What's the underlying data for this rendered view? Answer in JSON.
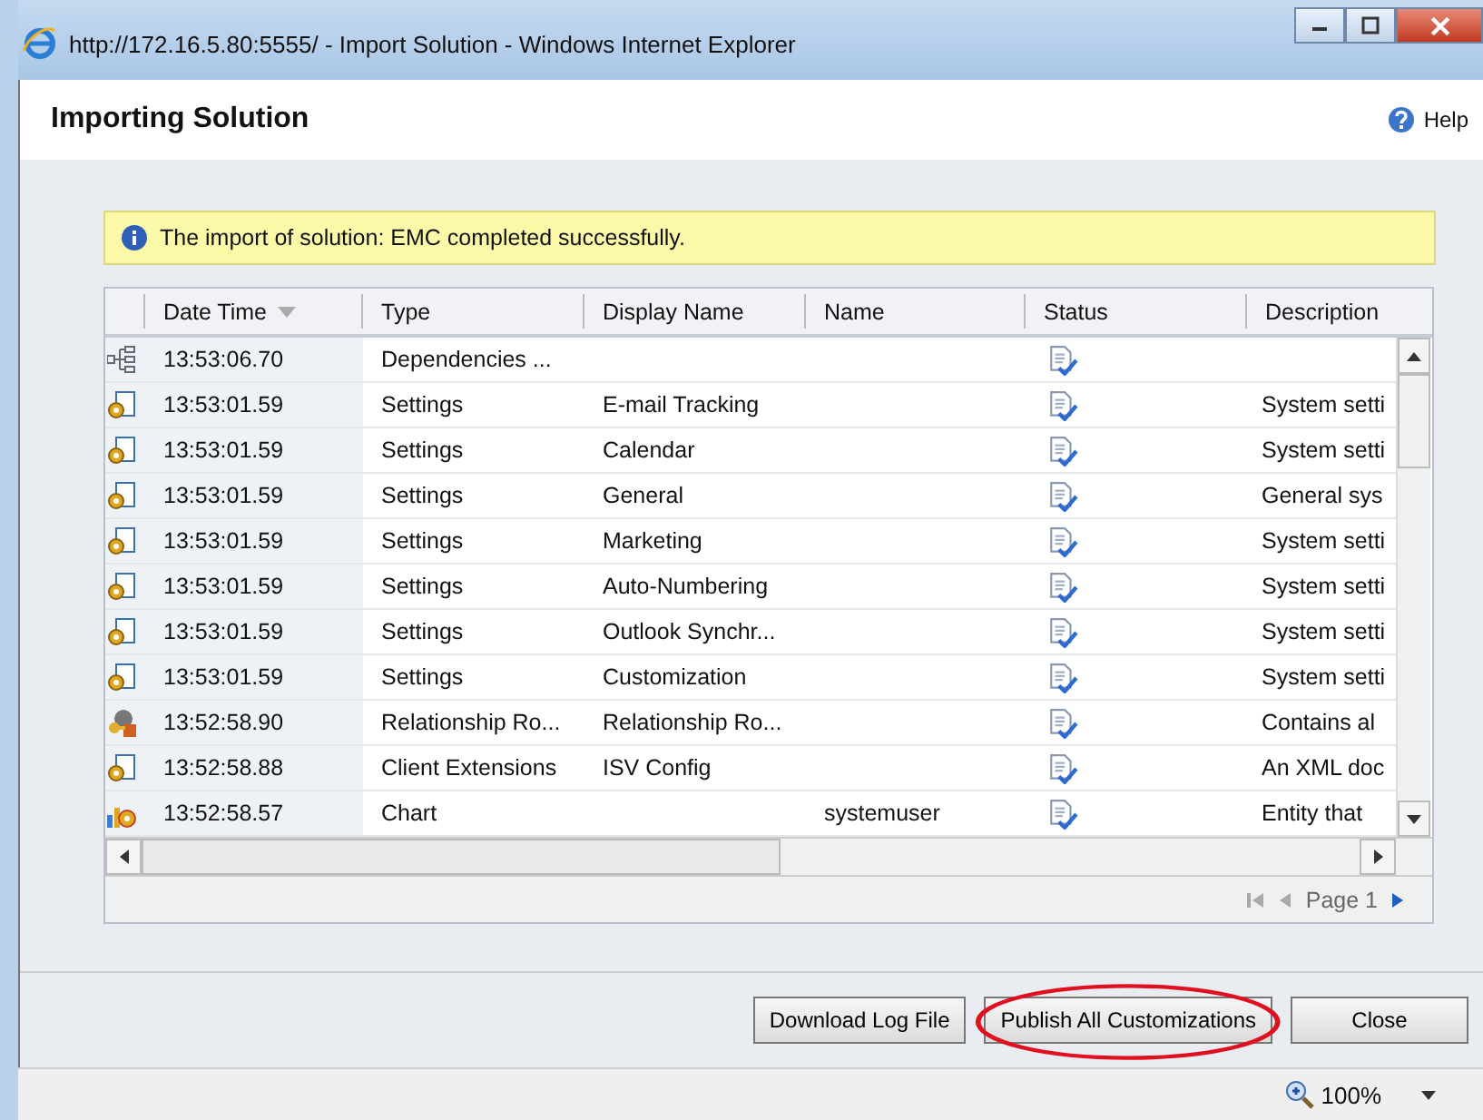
{
  "window": {
    "title": "http://172.16.5.80:5555/ - Import Solution - Windows Internet Explorer"
  },
  "dialog": {
    "title": "Importing Solution",
    "help": "Help"
  },
  "notice": "The import of solution: EMC completed successfully.",
  "table": {
    "columns": [
      {
        "label": "Date Time",
        "sorted": true
      },
      {
        "label": "Type",
        "sorted": false
      },
      {
        "label": "Display Name",
        "sorted": false
      },
      {
        "label": "Name",
        "sorted": false
      },
      {
        "label": "Status",
        "sorted": false
      },
      {
        "label": "Description",
        "sorted": false
      }
    ],
    "rows": [
      {
        "kind": "dependencies",
        "time": "13:53:06.70",
        "type": "Dependencies ...",
        "display_name": "",
        "name": "",
        "description": ""
      },
      {
        "kind": "settings",
        "time": "13:53:01.59",
        "type": "Settings",
        "display_name": "E-mail Tracking",
        "name": "",
        "description": "System setti"
      },
      {
        "kind": "settings",
        "time": "13:53:01.59",
        "type": "Settings",
        "display_name": "Calendar",
        "name": "",
        "description": "System setti"
      },
      {
        "kind": "settings",
        "time": "13:53:01.59",
        "type": "Settings",
        "display_name": "General",
        "name": "",
        "description": "General sys"
      },
      {
        "kind": "settings",
        "time": "13:53:01.59",
        "type": "Settings",
        "display_name": "Marketing",
        "name": "",
        "description": "System setti"
      },
      {
        "kind": "settings",
        "time": "13:53:01.59",
        "type": "Settings",
        "display_name": "Auto-Numbering",
        "name": "",
        "description": "System setti"
      },
      {
        "kind": "settings",
        "time": "13:53:01.59",
        "type": "Settings",
        "display_name": "Outlook Synchr...",
        "name": "",
        "description": "System setti"
      },
      {
        "kind": "settings",
        "time": "13:53:01.59",
        "type": "Settings",
        "display_name": "Customization",
        "name": "",
        "description": "System setti"
      },
      {
        "kind": "relationship",
        "time": "13:52:58.90",
        "type": "Relationship Ro...",
        "display_name": "Relationship Ro...",
        "name": "",
        "description": "Contains al"
      },
      {
        "kind": "settings",
        "time": "13:52:58.88",
        "type": "Client Extensions",
        "display_name": "ISV Config",
        "name": "",
        "description": "An XML doc"
      },
      {
        "kind": "chart",
        "time": "13:52:58.57",
        "type": "Chart",
        "display_name": "",
        "name": "systemuser",
        "description": "Entity that"
      }
    ],
    "page": "Page 1"
  },
  "buttons": [
    {
      "label": "Download Log File",
      "highlighted": false
    },
    {
      "label": "Publish All Customizations",
      "highlighted": true
    },
    {
      "label": "Close",
      "highlighted": false
    }
  ],
  "status_bar": {
    "zoom": "100%"
  }
}
